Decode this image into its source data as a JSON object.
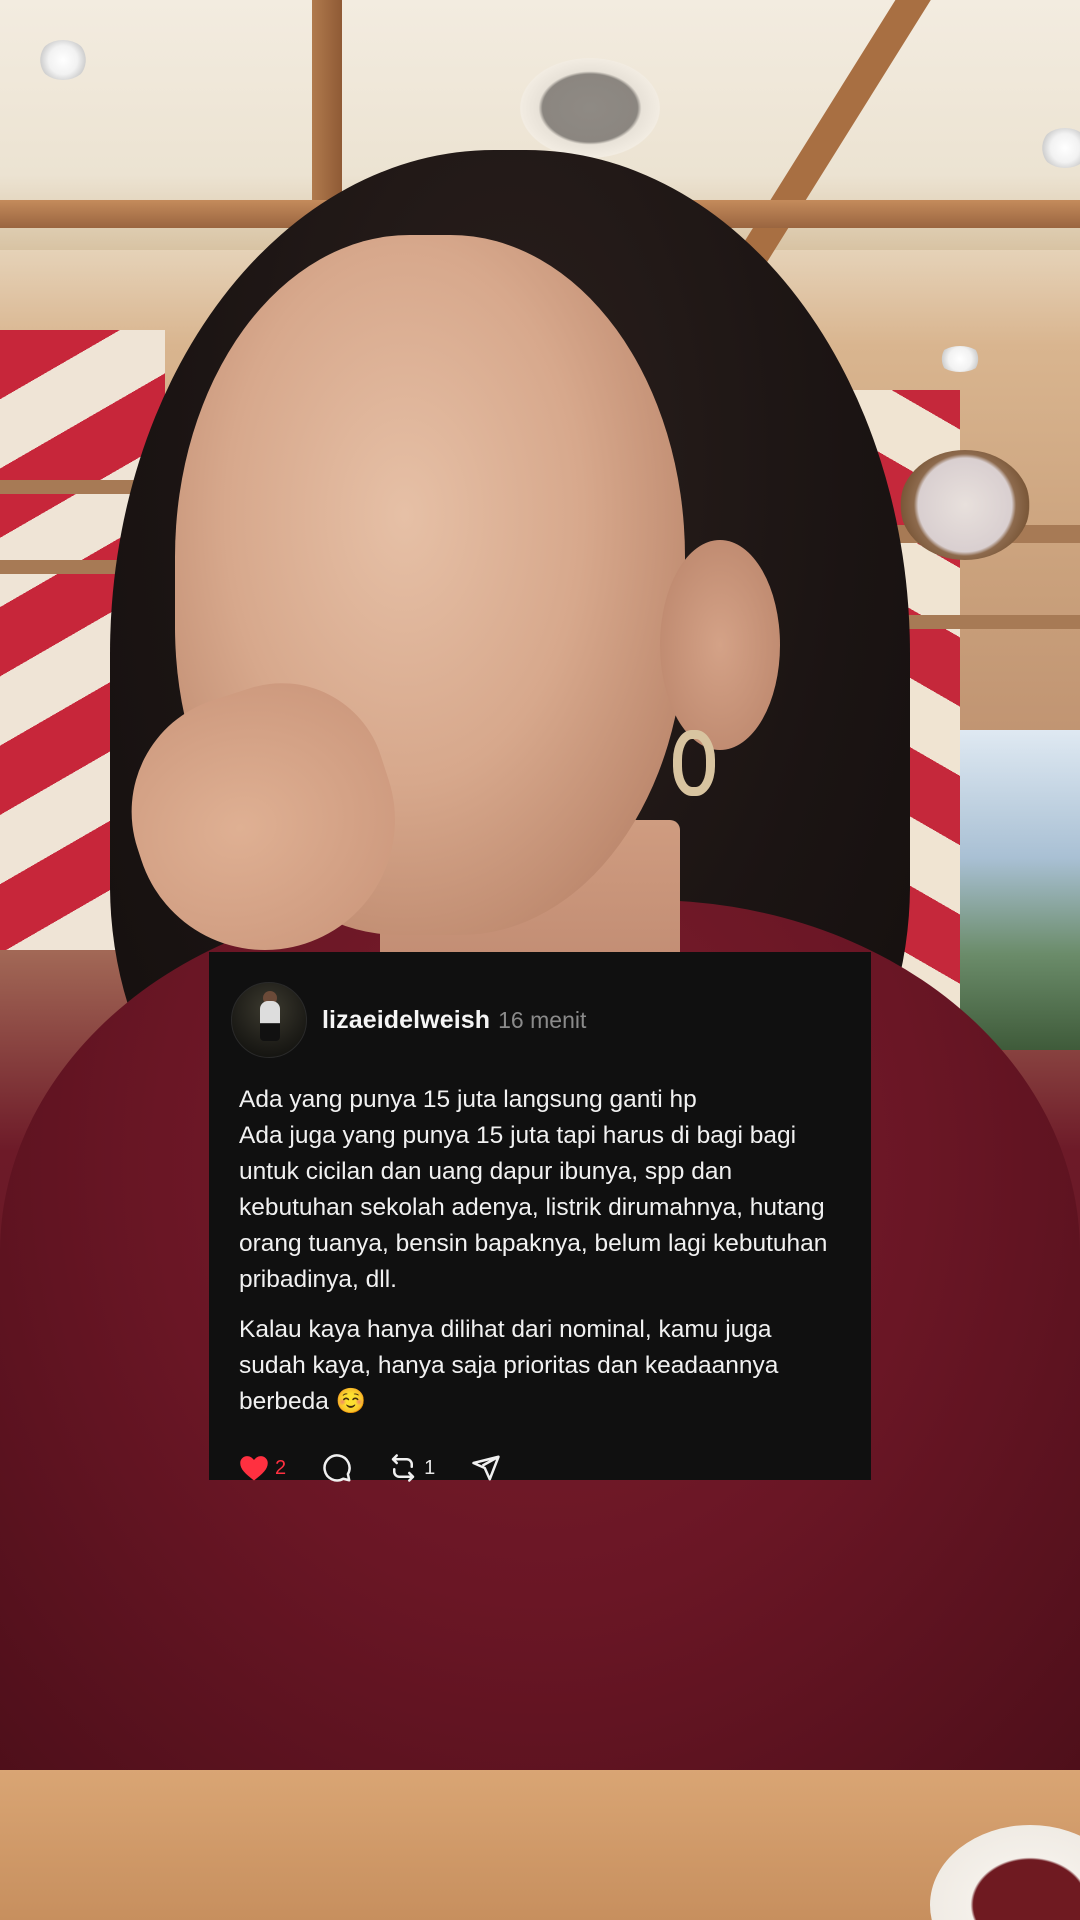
{
  "post": {
    "username": "lizaeidelweish",
    "time": "16 menit",
    "lines": [
      "Ada yang punya 15 juta langsung ganti hp",
      "Ada juga yang punya 15 juta tapi harus di bagi bagi untuk cicilan dan uang dapur ibunya, spp dan kebutuhan sekolah adenya, listrik dirumahnya, hutang orang tuanya, bensin bapaknya, belum lagi kebutuhan pribadinya, dll."
    ],
    "paragraph2": "Kalau kaya hanya dilihat dari nominal, kamu juga sudah kaya, hanya saja prioritas dan keadaannya berbeda ☺️",
    "likes": "2",
    "reposts": "1",
    "like_color": "#ff3040",
    "icons": [
      "heart-icon",
      "comment-icon",
      "repost-icon",
      "share-icon"
    ]
  }
}
